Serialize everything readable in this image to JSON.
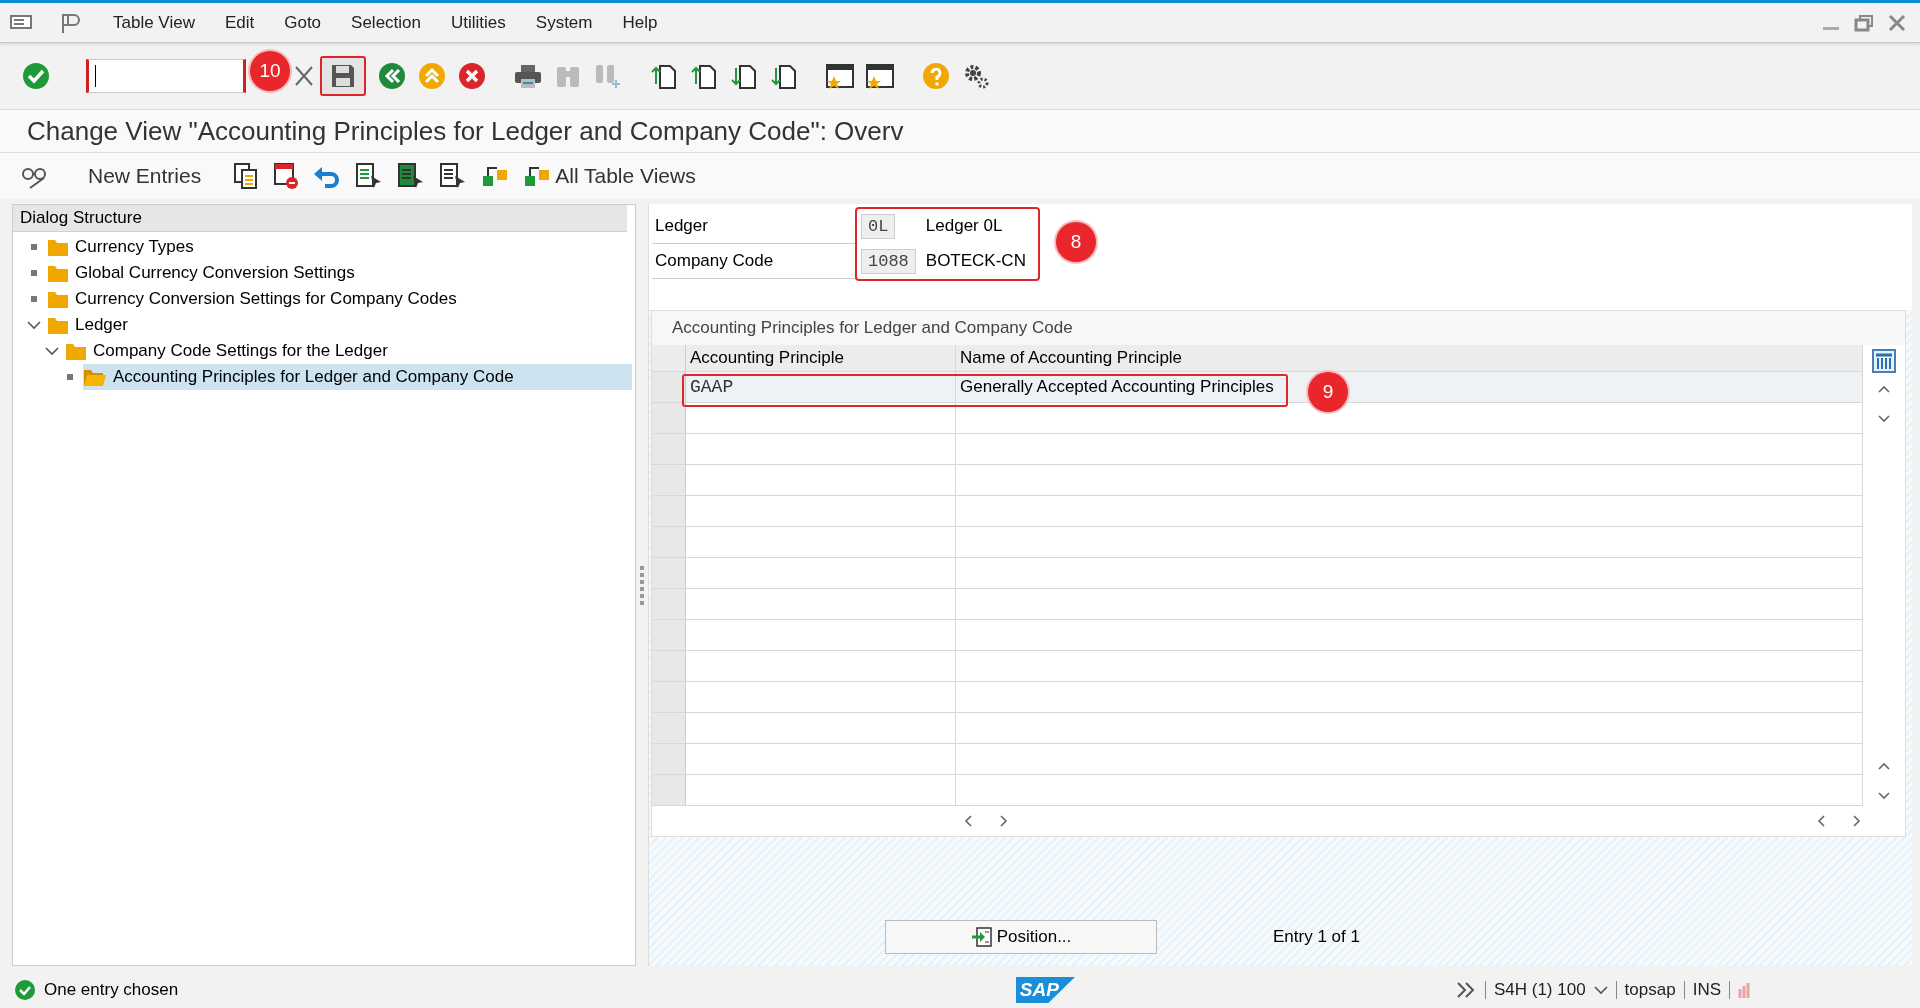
{
  "menu": [
    "Table View",
    "Edit",
    "Goto",
    "Selection",
    "Utilities",
    "System",
    "Help"
  ],
  "title": "Change View \"Accounting Principles for Ledger and Company Code\": Overv",
  "app_toolbar": [
    {
      "label": "New Entries"
    },
    {
      "label": "All Table Views"
    }
  ],
  "dialog_structure": {
    "title": "Dialog Structure",
    "items": [
      {
        "label": "Currency Types",
        "selected": false
      },
      {
        "label": "Global Currency Conversion Settings",
        "selected": false
      },
      {
        "label": "Currency Conversion Settings for Company Codes",
        "selected": false
      },
      {
        "label": "Ledger",
        "selected": false,
        "expanded": true,
        "children": [
          {
            "label": "Company Code Settings for the Ledger",
            "selected": false,
            "expanded": true,
            "children": [
              {
                "label": "Accounting Principles for Ledger and Company Code",
                "selected": true
              }
            ]
          }
        ]
      }
    ]
  },
  "header_fields": [
    {
      "label": "Ledger",
      "value": "0L",
      "description": "Ledger 0L"
    },
    {
      "label": "Company Code",
      "value": "1088",
      "description": "BOTECK-CN"
    }
  ],
  "table": {
    "title": "Accounting Principles for Ledger and Company Code",
    "columns": [
      "Accounting Principle",
      "Name of Accounting Principle"
    ],
    "rows": [
      [
        "GAAP",
        "Generally Accepted Accounting Principles"
      ]
    ]
  },
  "position_button": "Position...",
  "entry_info": "Entry 1 of 1",
  "status_bar": {
    "message": "One entry chosen",
    "system": "S4H (1) 100",
    "user": "topsap",
    "mode": "INS"
  },
  "logo": "SAP",
  "annotations": [
    {
      "kind": "toolbar",
      "label": "10"
    },
    {
      "kind": "header",
      "label": "8"
    },
    {
      "kind": "row",
      "label": "9"
    }
  ]
}
